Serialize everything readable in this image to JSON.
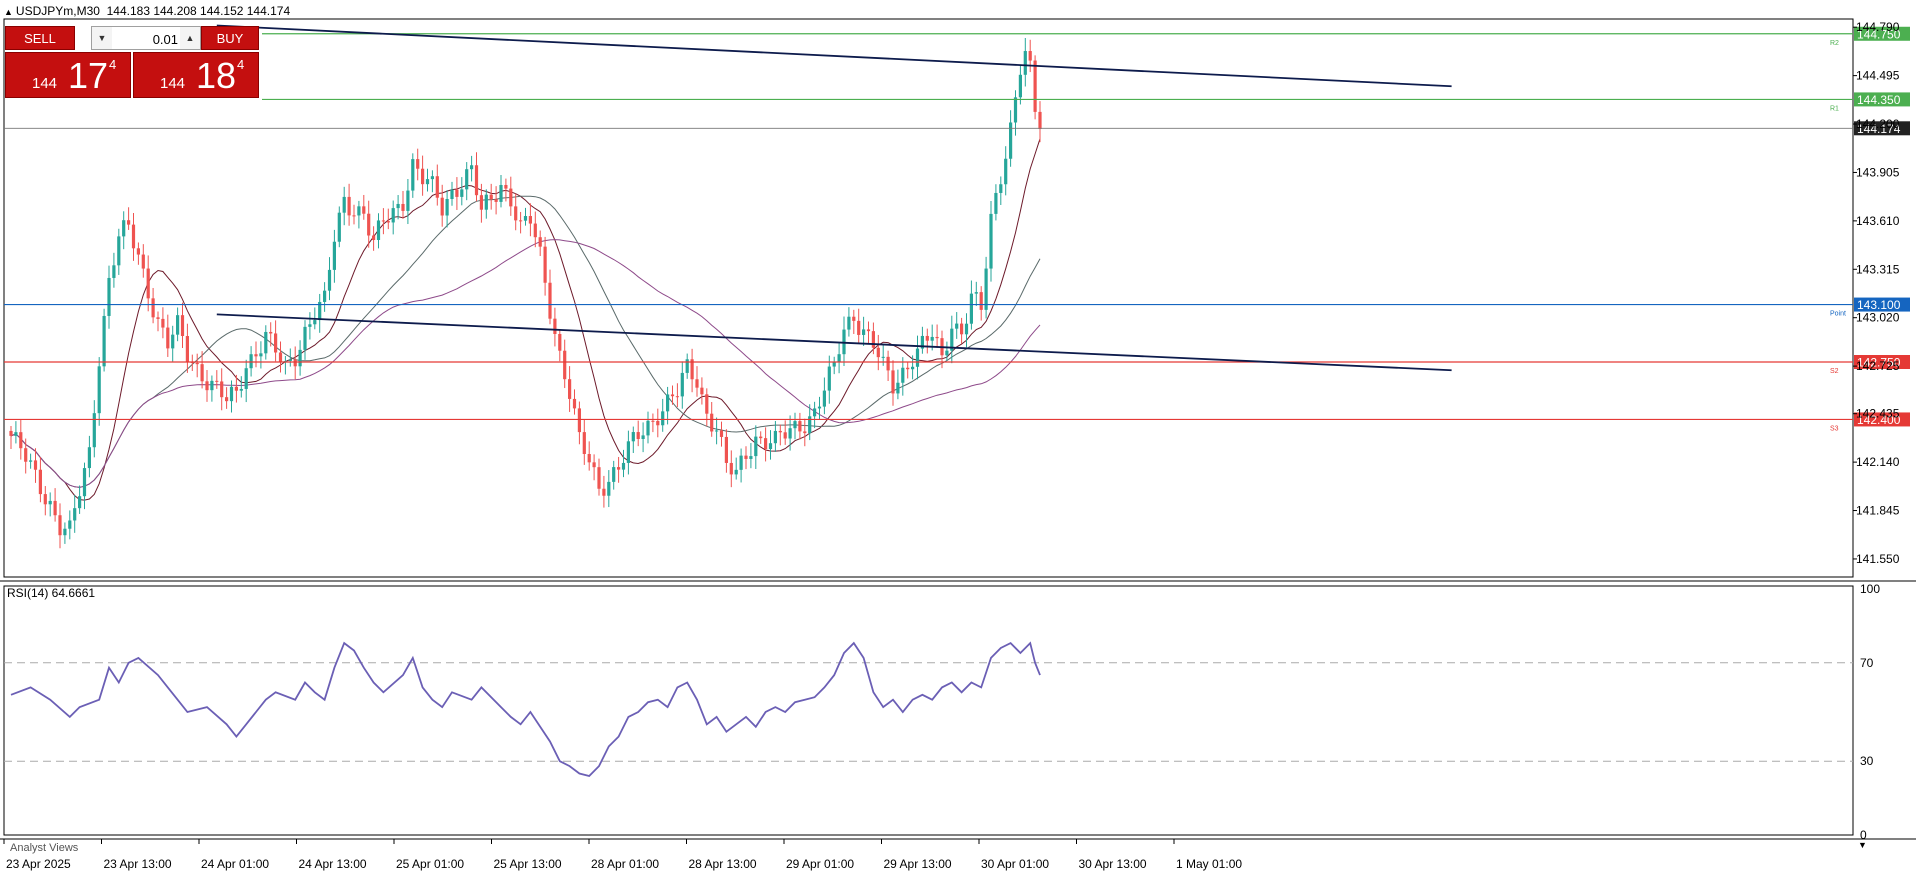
{
  "header": {
    "symbol": "USDJPYm,M30",
    "ohlc": "144.183 144.208 144.152 144.174"
  },
  "trade_panel": {
    "sell_label": "SELL",
    "buy_label": "BUY",
    "lot_value": "0.01",
    "sell_price_small": "144",
    "sell_price_large": "17",
    "sell_price_sup": "4",
    "buy_price_small": "144",
    "buy_price_large": "18",
    "buy_price_sup": "4"
  },
  "rsi_label": "RSI(14) 64.6661",
  "analyst_label": "Analyst Views",
  "colors": {
    "bull": "#26a69a",
    "bear": "#ef5350",
    "green_level": "#4caf50",
    "blue_level": "#1565c0",
    "red_level": "#e53935",
    "trendline": "#0d1b4c",
    "rsi": "#6b5fb5",
    "ma_fast": "#6d1a2a",
    "ma_mid": "#5a6a6a",
    "ma_slow": "#8e4a8a"
  },
  "chart_data": {
    "type": "candlestick",
    "price_axis": {
      "ticks": [
        "144.790",
        "144.495",
        "144.200",
        "143.905",
        "143.610",
        "143.315",
        "143.020",
        "142.725",
        "142.435",
        "142.140",
        "141.845",
        "141.550"
      ],
      "range": [
        141.44,
        144.84
      ]
    },
    "time_axis": {
      "labels": [
        "23 Apr 2025",
        "23 Apr 13:00",
        "24 Apr 01:00",
        "24 Apr 13:00",
        "25 Apr 01:00",
        "25 Apr 13:00",
        "28 Apr 01:00",
        "28 Apr 13:00",
        "29 Apr 01:00",
        "29 Apr 13:00",
        "30 Apr 01:00",
        "30 Apr 13:00",
        "1 May 01:00"
      ]
    },
    "close_path": [
      [
        0,
        142.3
      ],
      [
        4,
        142.1
      ],
      [
        8,
        141.9
      ],
      [
        10,
        141.75
      ],
      [
        12,
        141.7
      ],
      [
        14,
        141.95
      ],
      [
        16,
        142.2
      ],
      [
        18,
        142.8
      ],
      [
        20,
        143.25
      ],
      [
        22,
        143.5
      ],
      [
        24,
        143.55
      ],
      [
        26,
        143.4
      ],
      [
        28,
        143.2
      ],
      [
        30,
        143.0
      ],
      [
        32,
        142.85
      ],
      [
        34,
        142.95
      ],
      [
        36,
        142.8
      ],
      [
        40,
        142.65
      ],
      [
        44,
        142.5
      ],
      [
        46,
        142.55
      ],
      [
        48,
        142.75
      ],
      [
        52,
        142.9
      ],
      [
        56,
        142.7
      ],
      [
        58,
        142.8
      ],
      [
        60,
        142.95
      ],
      [
        62,
        143.05
      ],
      [
        64,
        143.1
      ],
      [
        66,
        143.5
      ],
      [
        68,
        143.75
      ],
      [
        72,
        143.65
      ],
      [
        74,
        143.45
      ],
      [
        76,
        143.6
      ],
      [
        80,
        143.75
      ],
      [
        82,
        143.95
      ],
      [
        84,
        143.85
      ],
      [
        86,
        143.8
      ],
      [
        88,
        143.7
      ],
      [
        90,
        143.8
      ],
      [
        94,
        143.9
      ],
      [
        96,
        143.65
      ],
      [
        100,
        143.85
      ],
      [
        102,
        143.75
      ],
      [
        104,
        143.55
      ],
      [
        106,
        143.6
      ],
      [
        108,
        143.4
      ],
      [
        110,
        143.1
      ],
      [
        112,
        142.8
      ],
      [
        114,
        142.55
      ],
      [
        116,
        142.25
      ],
      [
        118,
        142.15
      ],
      [
        120,
        142.0
      ],
      [
        124,
        142.1
      ],
      [
        128,
        142.3
      ],
      [
        132,
        142.45
      ],
      [
        136,
        142.55
      ],
      [
        138,
        142.7
      ],
      [
        140,
        142.65
      ],
      [
        142,
        142.45
      ],
      [
        144,
        142.35
      ],
      [
        146,
        142.1
      ],
      [
        148,
        142.05
      ],
      [
        150,
        142.2
      ],
      [
        152,
        142.3
      ],
      [
        156,
        142.25
      ],
      [
        160,
        142.35
      ],
      [
        164,
        142.45
      ],
      [
        168,
        142.7
      ],
      [
        170,
        142.95
      ],
      [
        172,
        143.05
      ],
      [
        174,
        142.95
      ],
      [
        176,
        142.85
      ],
      [
        178,
        142.7
      ],
      [
        180,
        142.6
      ],
      [
        184,
        142.8
      ],
      [
        188,
        142.9
      ],
      [
        190,
        142.75
      ],
      [
        192,
        143.0
      ],
      [
        194,
        142.95
      ],
      [
        196,
        143.15
      ],
      [
        198,
        143.05
      ],
      [
        200,
        143.6
      ],
      [
        202,
        143.9
      ],
      [
        204,
        144.2
      ],
      [
        206,
        144.55
      ],
      [
        207,
        144.62
      ],
      [
        208,
        144.5
      ],
      [
        209,
        144.25
      ],
      [
        210,
        144.17
      ]
    ],
    "levels": [
      {
        "label": "144.750",
        "value": 144.75,
        "tag": "R2",
        "color": "green"
      },
      {
        "label": "144.350",
        "value": 144.35,
        "tag": "R1",
        "color": "green"
      },
      {
        "label": "144.174",
        "value": 144.174,
        "tag": "",
        "color": "current"
      },
      {
        "label": "143.100",
        "value": 143.1,
        "tag": "Point",
        "color": "blue"
      },
      {
        "label": "142.750",
        "value": 142.75,
        "tag": "S2",
        "color": "red"
      },
      {
        "label": "142.400",
        "value": 142.4,
        "tag": "S3",
        "color": "red"
      }
    ],
    "trendlines": [
      {
        "from": [
          42,
          144.8
        ],
        "to": [
          294,
          144.43
        ]
      },
      {
        "from": [
          42,
          143.04
        ],
        "to": [
          294,
          142.7
        ]
      }
    ],
    "rsi": {
      "axis": [
        "100",
        "70",
        "30",
        "0"
      ],
      "levels": [
        70,
        30
      ],
      "values": [
        [
          0,
          57
        ],
        [
          4,
          60
        ],
        [
          8,
          55
        ],
        [
          12,
          48
        ],
        [
          14,
          52
        ],
        [
          18,
          55
        ],
        [
          20,
          68
        ],
        [
          22,
          62
        ],
        [
          24,
          70
        ],
        [
          26,
          72
        ],
        [
          30,
          65
        ],
        [
          32,
          60
        ],
        [
          34,
          55
        ],
        [
          36,
          50
        ],
        [
          40,
          52
        ],
        [
          44,
          45
        ],
        [
          46,
          40
        ],
        [
          48,
          45
        ],
        [
          50,
          50
        ],
        [
          52,
          55
        ],
        [
          54,
          58
        ],
        [
          58,
          55
        ],
        [
          60,
          62
        ],
        [
          62,
          58
        ],
        [
          64,
          55
        ],
        [
          66,
          68
        ],
        [
          68,
          78
        ],
        [
          70,
          75
        ],
        [
          72,
          68
        ],
        [
          74,
          62
        ],
        [
          76,
          58
        ],
        [
          80,
          65
        ],
        [
          82,
          72
        ],
        [
          84,
          60
        ],
        [
          86,
          55
        ],
        [
          88,
          52
        ],
        [
          90,
          58
        ],
        [
          94,
          55
        ],
        [
          96,
          60
        ],
        [
          100,
          52
        ],
        [
          102,
          48
        ],
        [
          104,
          45
        ],
        [
          106,
          50
        ],
        [
          108,
          44
        ],
        [
          110,
          38
        ],
        [
          112,
          30
        ],
        [
          114,
          28
        ],
        [
          116,
          25
        ],
        [
          118,
          24
        ],
        [
          120,
          28
        ],
        [
          122,
          36
        ],
        [
          124,
          40
        ],
        [
          126,
          48
        ],
        [
          128,
          50
        ],
        [
          130,
          54
        ],
        [
          132,
          55
        ],
        [
          134,
          52
        ],
        [
          136,
          60
        ],
        [
          138,
          62
        ],
        [
          140,
          55
        ],
        [
          142,
          45
        ],
        [
          144,
          48
        ],
        [
          146,
          42
        ],
        [
          148,
          45
        ],
        [
          150,
          48
        ],
        [
          152,
          44
        ],
        [
          154,
          50
        ],
        [
          156,
          52
        ],
        [
          158,
          50
        ],
        [
          160,
          54
        ],
        [
          162,
          55
        ],
        [
          164,
          56
        ],
        [
          166,
          60
        ],
        [
          168,
          65
        ],
        [
          170,
          74
        ],
        [
          172,
          78
        ],
        [
          174,
          72
        ],
        [
          176,
          58
        ],
        [
          178,
          52
        ],
        [
          180,
          55
        ],
        [
          182,
          50
        ],
        [
          184,
          55
        ],
        [
          186,
          57
        ],
        [
          188,
          55
        ],
        [
          190,
          60
        ],
        [
          192,
          62
        ],
        [
          194,
          58
        ],
        [
          196,
          62
        ],
        [
          198,
          60
        ],
        [
          200,
          72
        ],
        [
          202,
          76
        ],
        [
          204,
          78
        ],
        [
          206,
          74
        ],
        [
          208,
          78
        ],
        [
          209,
          70
        ],
        [
          210,
          65
        ]
      ]
    }
  }
}
